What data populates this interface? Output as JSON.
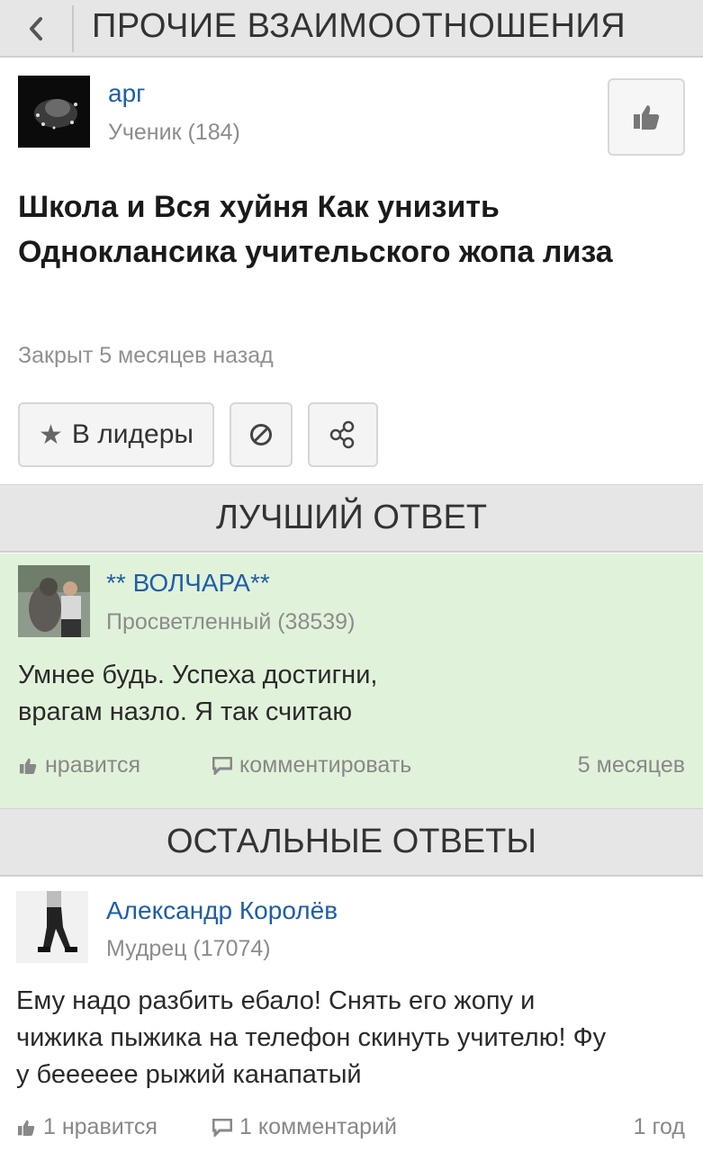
{
  "header": {
    "back_icon": "chevron-left-icon",
    "title": "ПРОЧИЕ ВЗАИМООТНОШЕНИЯ"
  },
  "question": {
    "author": {
      "name": "арг",
      "rank": "Ученик (184)"
    },
    "title": "Школа и Вся хуйня Как унизить Однoклансика учительского жопа лиза",
    "status": "Закрыт 5 месяцев назад",
    "actions": {
      "leaders_label": "В лидеры",
      "leaders_icon": "star-icon",
      "report_icon": "block-icon",
      "share_icon": "share-icon",
      "like_icon": "thumbs-up-icon"
    }
  },
  "sections": {
    "best_answer": "ЛУЧШИЙ ОТВЕТ",
    "other_answers": "ОСТАЛЬНЫЕ ОТВЕТЫ"
  },
  "best_answer": {
    "author": {
      "name": "** ВОЛЧАРА**",
      "rank": "Просветленный (38539)"
    },
    "line1": "Умнее будь. Успеха достигни,",
    "line2": "врагам назло. Я так считаю",
    "like_label": "нравится",
    "comment_label": "комментировать",
    "time": "5 месяцев"
  },
  "answers": [
    {
      "author": {
        "name": "Александр Королёв",
        "rank": "Мудрец (17074)"
      },
      "line1": "Ему надо разбить ебало! Снять его жопу и",
      "line2": "чижика пыжика на телефон скинуть учителю! Фу",
      "line3": "у беееeee рыжий канапатый",
      "like_label": "1 нравится",
      "comment_label": "1 комментарий",
      "time": "1 год"
    }
  ],
  "colors": {
    "link": "#1f5ea8",
    "best_answer_bg": "#e1f2da",
    "section_bg": "#e6e6e6"
  }
}
